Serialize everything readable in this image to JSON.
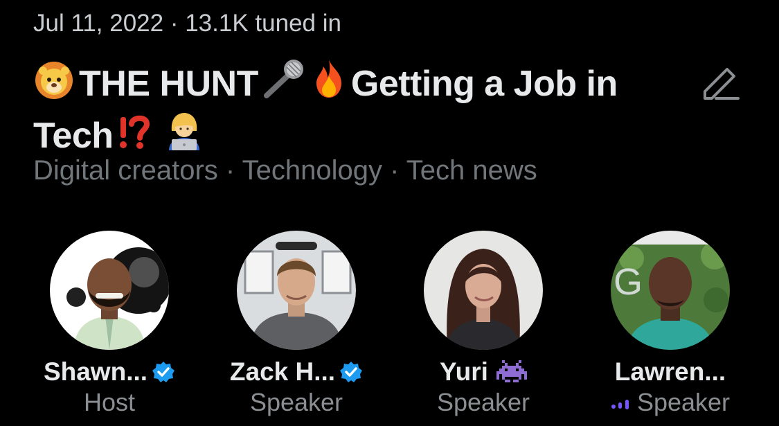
{
  "space": {
    "date": "Jul 11, 2022",
    "separator": " · ",
    "listeners": "13.1K tuned in",
    "title_part1": "THE HUNT",
    "title_part2": "Getting a Job in",
    "title_part3": "Tech",
    "title_emojis": [
      "lion-face-icon",
      "microphone-icon",
      "fire-icon",
      "exclamation-question-mark-icon",
      "woman-technologist-icon"
    ],
    "topics": [
      "Digital creators",
      "Technology",
      "Tech news"
    ]
  },
  "participants": [
    {
      "name": "Shawn...",
      "role": "Host",
      "verified": true,
      "speaking": false
    },
    {
      "name": "Zack H...",
      "role": "Speaker",
      "verified": true,
      "speaking": false
    },
    {
      "name": "Yuri",
      "role": "Speaker",
      "verified": false,
      "emoji": "alien-monster-icon",
      "speaking": false
    },
    {
      "name": "Lawren...",
      "role": "Speaker",
      "verified": false,
      "speaking": true
    }
  ],
  "colors": {
    "background": "#000000",
    "text": "#e7e9ea",
    "muted": "#71767b",
    "verified": "#1d9bf0",
    "speaking_indicator": "#7856ff"
  }
}
